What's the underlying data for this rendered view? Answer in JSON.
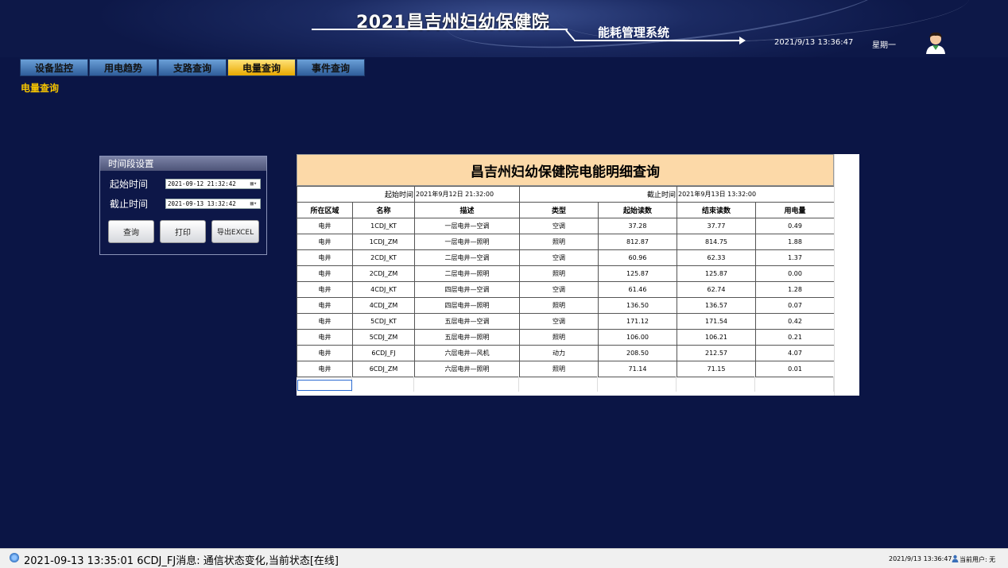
{
  "header": {
    "title": "2021昌吉州妇幼保健院",
    "subtitle": "能耗管理系统",
    "datetime": "2021/9/13 13:36:47",
    "weekday": "星期一"
  },
  "nav": {
    "tabs": [
      {
        "label": "设备监控",
        "active": false
      },
      {
        "label": "用电趋势",
        "active": false
      },
      {
        "label": "支路查询",
        "active": false
      },
      {
        "label": "电量查询",
        "active": true
      },
      {
        "label": "事件查询",
        "active": false
      }
    ]
  },
  "page": {
    "label": "电量查询"
  },
  "time_panel": {
    "title": "时间段设置",
    "start_label": "起始时间",
    "start_value": "2021-09-12 21:32:42",
    "end_label": "截止时间",
    "end_value": "2021-09-13 13:32:42",
    "query_btn": "查询",
    "print_btn": "打印",
    "export_btn": "导出EXCEL"
  },
  "report": {
    "title": "昌吉州妇幼保健院电能明细查询",
    "start_label": "起始时间",
    "start_value": "2021年9月12日 21:32:00",
    "end_label": "截止时间",
    "end_value": "2021年9月13日 13:32:00",
    "columns": [
      "所在区域",
      "名称",
      "描述",
      "类型",
      "起始读数",
      "结束读数",
      "用电量"
    ],
    "rows": [
      [
        "电井",
        "1CDJ_KT",
        "一层电井—空调",
        "空调",
        "37.28",
        "37.77",
        "0.49"
      ],
      [
        "电井",
        "1CDJ_ZM",
        "一层电井—照明",
        "照明",
        "812.87",
        "814.75",
        "1.88"
      ],
      [
        "电井",
        "2CDJ_KT",
        "二层电井—空调",
        "空调",
        "60.96",
        "62.33",
        "1.37"
      ],
      [
        "电井",
        "2CDJ_ZM",
        "二层电井—照明",
        "照明",
        "125.87",
        "125.87",
        "0.00"
      ],
      [
        "电井",
        "4CDJ_KT",
        "四层电井—空调",
        "空调",
        "61.46",
        "62.74",
        "1.28"
      ],
      [
        "电井",
        "4CDJ_ZM",
        "四层电井—照明",
        "照明",
        "136.50",
        "136.57",
        "0.07"
      ],
      [
        "电井",
        "5CDJ_KT",
        "五层电井—空调",
        "空调",
        "171.12",
        "171.54",
        "0.42"
      ],
      [
        "电井",
        "5CDJ_ZM",
        "五层电井—照明",
        "照明",
        "106.00",
        "106.21",
        "0.21"
      ],
      [
        "电井",
        "6CDJ_FJ",
        "六层电井—风机",
        "动力",
        "208.50",
        "212.57",
        "4.07"
      ],
      [
        "电井",
        "6CDJ_ZM",
        "六层电井—照明",
        "照明",
        "71.14",
        "71.15",
        "0.01"
      ]
    ]
  },
  "statusbar": {
    "message": "2021-09-13 13:35:01   6CDJ_FJ消息:   通信状态变化,当前状态[在线]",
    "time": "2021/9/13 13:36:47",
    "user": "当前用户: 无"
  },
  "icons": {
    "avatar": "user-avatar-icon",
    "status": "info-icon",
    "calendar": "calendar-icon",
    "user": "user-icon"
  }
}
